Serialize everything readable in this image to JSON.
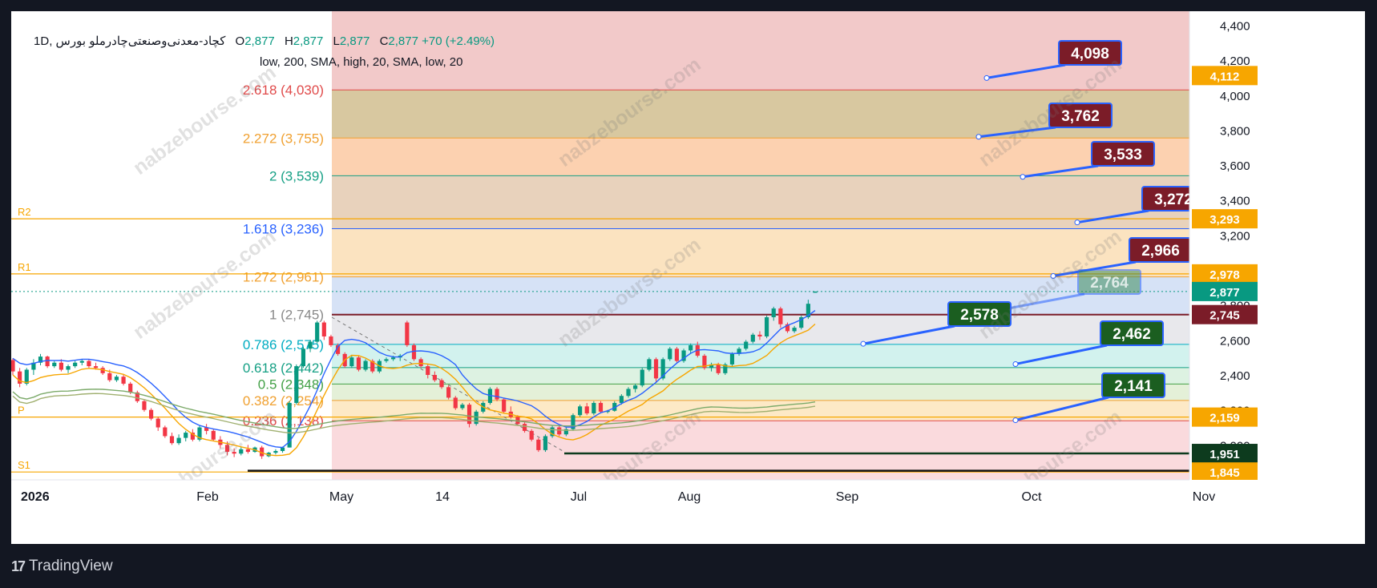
{
  "header": {
    "symbol": "کچاد-معدنی‌وصنعتی‌چادرملو",
    "interval": "1D",
    "exchange": "بورس",
    "ohlc": {
      "o": "2,877",
      "h": "2,877",
      "l": "2,877",
      "c": "2,877",
      "change": "+70 (+2.49%)"
    },
    "indicators": "low, 200, SMA, high, 20, SMA, low, 20"
  },
  "branding": {
    "name": "TradingView",
    "logo": "17"
  },
  "watermark": "nabzebourse.com",
  "colors": {
    "background": "#131722",
    "up": "#089981",
    "down": "#f23645",
    "ema_blue": "#2962ff",
    "ema_orange": "#f7a600",
    "sma_green": "#7caa6a",
    "box_red": "#7b1c28",
    "box_green": "#1b5e20",
    "box_border": "#2962ff"
  },
  "chart_data": {
    "type": "candlestick",
    "y_axis": {
      "ylim": [
        1800,
        4480
      ],
      "ticks": [
        "2,000",
        "2,200",
        "2,400",
        "2,600",
        "2,800",
        "3,000",
        "3,200",
        "3,400",
        "3,600",
        "3,800",
        "4,000",
        "4,200",
        "4,400"
      ]
    },
    "x_axis": {
      "labels": [
        "2026",
        "Feb",
        "May",
        "14",
        "Jul",
        "Aug",
        "Sep",
        "Oct",
        "Nov"
      ]
    },
    "price_labels": [
      {
        "text": "4,112",
        "value": 4112,
        "color": "#f7a600"
      },
      {
        "text": "3,293",
        "value": 3293,
        "color": "#f7a600"
      },
      {
        "text": "2,978",
        "value": 2978,
        "color": "#f7a600"
      },
      {
        "text": "2,877",
        "value": 2877,
        "color": "#089981"
      },
      {
        "text": "2,745",
        "value": 2745,
        "color": "#7b1c28"
      },
      {
        "text": "2,159",
        "value": 2159,
        "color": "#f7a600"
      },
      {
        "text": "1,951",
        "value": 1951,
        "color": "#0d3b1e"
      },
      {
        "text": "1,845",
        "value": 1845,
        "color": "#f7a600"
      }
    ],
    "fib_levels": [
      {
        "ratio": "2.618",
        "value": "4,030",
        "price": 4030,
        "color": "#e04a4a"
      },
      {
        "ratio": "2.272",
        "value": "3,755",
        "price": 3755,
        "color": "#f0a030"
      },
      {
        "ratio": "2",
        "value": "3,539",
        "price": 3539,
        "color": "#16a085"
      },
      {
        "ratio": "1.618",
        "value": "3,236",
        "price": 3236,
        "color": "#2962ff"
      },
      {
        "ratio": "1.272",
        "value": "2,961",
        "price": 2961,
        "color": "#f0a030"
      },
      {
        "ratio": "1",
        "value": "2,745",
        "price": 2745,
        "color": "#888888"
      },
      {
        "ratio": "0.786",
        "value": "2,575",
        "price": 2575,
        "color": "#00acc1"
      },
      {
        "ratio": "0.618",
        "value": "2,442",
        "price": 2442,
        "color": "#16a085"
      },
      {
        "ratio": "0.5",
        "value": "2,348",
        "price": 2348,
        "color": "#43a047"
      },
      {
        "ratio": "0.382",
        "value": "2,254",
        "price": 2254,
        "color": "#f0a030"
      },
      {
        "ratio": "0.236",
        "value": "2,138",
        "price": 2138,
        "color": "#e04a4a"
      }
    ],
    "pivots": [
      {
        "name": "R2",
        "price": 3293
      },
      {
        "name": "R1",
        "price": 2978
      },
      {
        "name": "P",
        "price": 2159
      },
      {
        "name": "S1",
        "price": 1845
      }
    ],
    "targets": [
      {
        "text": "4,098",
        "price": 4098,
        "kind": "red"
      },
      {
        "text": "3,762",
        "price": 3762,
        "kind": "red"
      },
      {
        "text": "3,533",
        "price": 3533,
        "kind": "red"
      },
      {
        "text": "3,272",
        "price": 3272,
        "kind": "red"
      },
      {
        "text": "2,966",
        "price": 2966,
        "kind": "red"
      },
      {
        "text": "2,764",
        "price": 2764,
        "kind": "faded"
      },
      {
        "text": "2,578",
        "price": 2578,
        "kind": "green"
      },
      {
        "text": "2,462",
        "price": 2462,
        "kind": "green"
      },
      {
        "text": "2,141",
        "price": 2141,
        "kind": "green"
      }
    ],
    "candles": [
      [
        2485,
        2495,
        2400,
        2420
      ],
      [
        2420,
        2440,
        2330,
        2350
      ],
      [
        2350,
        2440,
        2340,
        2430
      ],
      [
        2430,
        2490,
        2400,
        2470
      ],
      [
        2470,
        2520,
        2455,
        2505
      ],
      [
        2505,
        2510,
        2440,
        2450
      ],
      [
        2450,
        2480,
        2440,
        2470
      ],
      [
        2470,
        2490,
        2420,
        2430
      ],
      [
        2430,
        2460,
        2410,
        2450
      ],
      [
        2450,
        2480,
        2440,
        2470
      ],
      [
        2470,
        2490,
        2455,
        2480
      ],
      [
        2480,
        2490,
        2440,
        2450
      ],
      [
        2450,
        2470,
        2430,
        2440
      ],
      [
        2440,
        2450,
        2400,
        2410
      ],
      [
        2410,
        2430,
        2360,
        2370
      ],
      [
        2370,
        2400,
        2360,
        2390
      ],
      [
        2390,
        2400,
        2340,
        2350
      ],
      [
        2350,
        2360,
        2290,
        2300
      ],
      [
        2300,
        2310,
        2240,
        2250
      ],
      [
        2250,
        2260,
        2190,
        2200
      ],
      [
        2200,
        2210,
        2140,
        2150
      ],
      [
        2150,
        2160,
        2080,
        2100
      ],
      [
        2100,
        2110,
        2040,
        2050
      ],
      [
        2050,
        2070,
        2000,
        2010
      ],
      [
        2010,
        2060,
        2000,
        2040
      ],
      [
        2040,
        2080,
        2020,
        2070
      ],
      [
        2070,
        2090,
        2020,
        2030
      ],
      [
        2030,
        2110,
        2020,
        2100
      ],
      [
        2100,
        2120,
        2060,
        2080
      ],
      [
        2080,
        2090,
        2020,
        2030
      ],
      [
        2030,
        2050,
        1980,
        2000
      ],
      [
        2000,
        2020,
        1940,
        1960
      ],
      [
        1960,
        1980,
        1930,
        1950
      ],
      [
        1950,
        1990,
        1940,
        1975
      ],
      [
        1975,
        2000,
        1950,
        1960
      ],
      [
        1960,
        1990,
        1955,
        1985
      ],
      [
        1985,
        1995,
        1920,
        1935
      ],
      [
        1935,
        1960,
        1930,
        1955
      ],
      [
        1955,
        1975,
        1945,
        1965
      ],
      [
        1965,
        1990,
        1955,
        1985
      ],
      [
        1985,
        2250,
        1985,
        2240
      ],
      [
        2240,
        2460,
        2230,
        2450
      ],
      [
        2450,
        2560,
        2440,
        2550
      ],
      [
        2550,
        2600,
        2530,
        2590
      ],
      [
        2590,
        2710,
        2580,
        2700
      ],
      [
        2700,
        2710,
        2600,
        2620
      ],
      [
        2620,
        2630,
        2560,
        2570
      ],
      [
        2570,
        2580,
        2510,
        2520
      ],
      [
        2520,
        2530,
        2440,
        2450
      ],
      [
        2450,
        2510,
        2440,
        2500
      ],
      [
        2500,
        2510,
        2420,
        2430
      ],
      [
        2430,
        2490,
        2420,
        2480
      ],
      [
        2480,
        2490,
        2410,
        2420
      ],
      [
        2420,
        2490,
        2410,
        2480
      ],
      [
        2480,
        2500,
        2470,
        2490
      ],
      [
        2490,
        2510,
        2480,
        2500
      ],
      [
        2500,
        2520,
        2480,
        2510
      ],
      [
        2700,
        2710,
        2560,
        2570
      ],
      [
        2570,
        2580,
        2480,
        2490
      ],
      [
        2490,
        2500,
        2440,
        2450
      ],
      [
        2450,
        2460,
        2380,
        2400
      ],
      [
        2400,
        2420,
        2360,
        2370
      ],
      [
        2370,
        2380,
        2320,
        2330
      ],
      [
        2330,
        2340,
        2260,
        2270
      ],
      [
        2270,
        2280,
        2200,
        2210
      ],
      [
        2210,
        2240,
        2200,
        2230
      ],
      [
        2230,
        2240,
        2100,
        2120
      ],
      [
        2120,
        2200,
        2110,
        2190
      ],
      [
        2190,
        2250,
        2180,
        2240
      ],
      [
        2240,
        2330,
        2230,
        2320
      ],
      [
        2320,
        2330,
        2250,
        2260
      ],
      [
        2260,
        2270,
        2180,
        2190
      ],
      [
        2190,
        2220,
        2150,
        2160
      ],
      [
        2160,
        2170,
        2110,
        2120
      ],
      [
        2120,
        2130,
        2070,
        2080
      ],
      [
        2080,
        2090,
        2020,
        2030
      ],
      [
        2030,
        2040,
        1960,
        1970
      ],
      [
        1970,
        2060,
        1960,
        2050
      ],
      [
        2050,
        2110,
        2040,
        2100
      ],
      [
        2100,
        2110,
        2050,
        2060
      ],
      [
        2060,
        2100,
        2050,
        2090
      ],
      [
        2090,
        2180,
        2080,
        2170
      ],
      [
        2170,
        2230,
        2160,
        2220
      ],
      [
        2220,
        2240,
        2170,
        2180
      ],
      [
        2180,
        2250,
        2170,
        2240
      ],
      [
        2240,
        2250,
        2180,
        2190
      ],
      [
        2190,
        2200,
        2180,
        2195
      ],
      [
        2195,
        2250,
        2190,
        2240
      ],
      [
        2240,
        2290,
        2230,
        2280
      ],
      [
        2280,
        2330,
        2270,
        2320
      ],
      [
        2320,
        2350,
        2300,
        2340
      ],
      [
        2340,
        2440,
        2330,
        2430
      ],
      [
        2430,
        2500,
        2420,
        2490
      ],
      [
        2490,
        2500,
        2360,
        2380
      ],
      [
        2380,
        2500,
        2370,
        2490
      ],
      [
        2490,
        2560,
        2480,
        2550
      ],
      [
        2550,
        2560,
        2470,
        2480
      ],
      [
        2480,
        2550,
        2470,
        2540
      ],
      [
        2540,
        2580,
        2520,
        2570
      ],
      [
        2570,
        2590,
        2500,
        2510
      ],
      [
        2510,
        2520,
        2430,
        2440
      ],
      [
        2440,
        2470,
        2420,
        2460
      ],
      [
        2460,
        2470,
        2400,
        2410
      ],
      [
        2410,
        2470,
        2400,
        2460
      ],
      [
        2460,
        2530,
        2450,
        2520
      ],
      [
        2520,
        2560,
        2510,
        2550
      ],
      [
        2550,
        2600,
        2540,
        2590
      ],
      [
        2590,
        2640,
        2580,
        2630
      ],
      [
        2630,
        2650,
        2600,
        2620
      ],
      [
        2620,
        2740,
        2610,
        2730
      ],
      [
        2730,
        2790,
        2710,
        2780
      ],
      [
        2780,
        2790,
        2670,
        2690
      ],
      [
        2690,
        2700,
        2640,
        2650
      ],
      [
        2650,
        2680,
        2640,
        2670
      ],
      [
        2670,
        2740,
        2660,
        2730
      ],
      [
        2730,
        2830,
        2720,
        2807
      ],
      [
        2877,
        2877,
        2877,
        2877
      ]
    ]
  }
}
